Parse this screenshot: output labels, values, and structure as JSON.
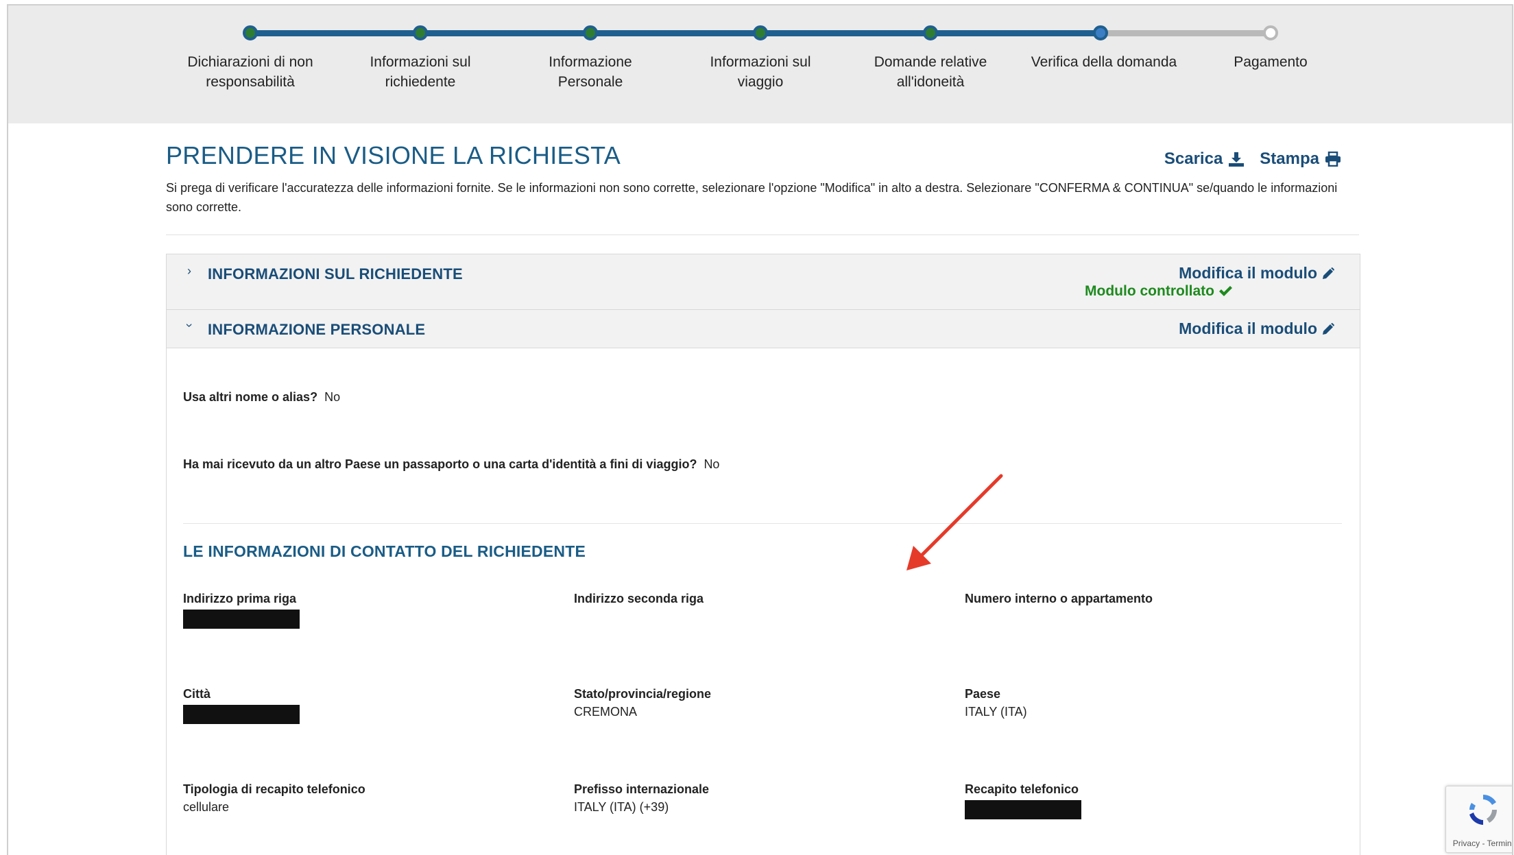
{
  "progress": {
    "steps": [
      {
        "label": "Dichiarazioni di non responsabilità",
        "state": "done"
      },
      {
        "label": "Informazioni sul richiedente",
        "state": "done"
      },
      {
        "label": "Informazione Personale",
        "state": "done"
      },
      {
        "label": "Informazioni sul viaggio",
        "state": "done"
      },
      {
        "label": "Domande relative all'idoneità",
        "state": "done"
      },
      {
        "label": "Verifica della domanda",
        "state": "current"
      },
      {
        "label": "Pagamento",
        "state": "todo"
      }
    ]
  },
  "header": {
    "title": "PRENDERE IN VISIONE LA RICHIESTA",
    "download_label": "Scarica",
    "print_label": "Stampa",
    "intro": "Si prega di verificare l'accuratezza delle informazioni fornite. Se le informazioni non sono corrette, selezionare l'opzione \"Modifica\" in alto a destra. Selezionare \"CONFERMA & CONTINUA\" se/quando le informazioni sono corrette."
  },
  "accordion": {
    "applicant": {
      "chevron": "›",
      "title": "INFORMAZIONI SUL RICHIEDENTE",
      "edit_label": "Modifica il modulo",
      "status": "Modulo controllato"
    },
    "personal": {
      "chevron": "›",
      "title": "INFORMAZIONE PERSONALE",
      "edit_label": "Modifica il modulo",
      "questions": [
        {
          "q": "Usa altri nome o alias?",
          "a": "No"
        },
        {
          "q": "Ha mai ricevuto da un altro Paese un passaporto o una carta d'identità a fini di viaggio?",
          "a": "No"
        }
      ],
      "contact_title": "LE INFORMAZIONI DI CONTATTO DEL RICHIEDENTE",
      "fields": {
        "address1": {
          "label": "Indirizzo prima riga",
          "value": "",
          "redacted": true
        },
        "address2": {
          "label": "Indirizzo seconda riga",
          "value": ""
        },
        "apartment": {
          "label": "Numero interno o appartamento",
          "value": ""
        },
        "city": {
          "label": "Città",
          "value": "",
          "redacted": true
        },
        "state": {
          "label": "Stato/provincia/regione",
          "value": "CREMONA"
        },
        "country": {
          "label": "Paese",
          "value": "ITALY (ITA)"
        },
        "phone_type": {
          "label": "Tipologia di recapito telefonico",
          "value": "cellulare"
        },
        "intl_prefix": {
          "label": "Prefisso internazionale",
          "value": "ITALY (ITA) (+39)"
        },
        "phone": {
          "label": "Recapito telefonico",
          "value": "",
          "redacted": true
        }
      }
    }
  },
  "recaptcha": {
    "footer": "Privacy - Termini"
  },
  "colors": {
    "accent_blue": "#1a5c86",
    "step_done_green": "#2e7d32",
    "status_green": "#1e8a1e",
    "annotation_red": "#e53a2a"
  }
}
